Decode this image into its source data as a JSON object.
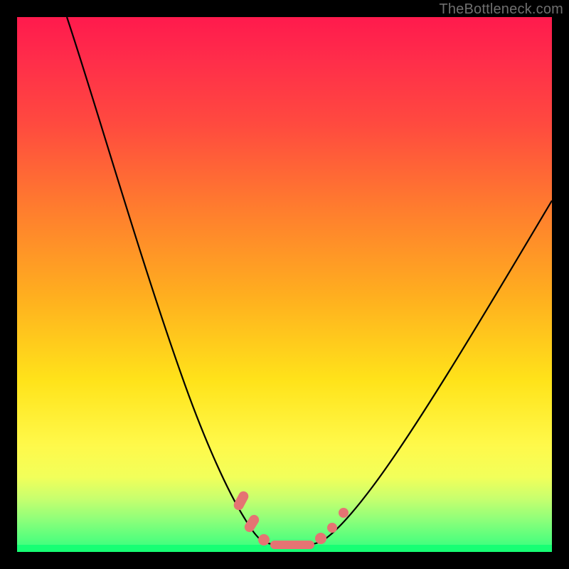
{
  "watermark": "TheBottleneck.com",
  "chart_data": {
    "type": "line",
    "title": "",
    "xlabel": "",
    "ylabel": "",
    "x_range": [
      0,
      100
    ],
    "y_range": [
      0,
      100
    ],
    "gradient_meaning": "vertical color gradient from red (top, ~100) to green (bottom, ~0)",
    "series": [
      {
        "name": "left-branch",
        "x": [
          10,
          14,
          18,
          22,
          26,
          30,
          34,
          37,
          39,
          41,
          43,
          44,
          45
        ],
        "y": [
          100,
          88,
          75,
          62,
          50,
          38,
          27,
          18,
          12,
          8,
          5,
          3,
          2
        ]
      },
      {
        "name": "valley-floor",
        "x": [
          45,
          47,
          49,
          51,
          53,
          55,
          57
        ],
        "y": [
          2,
          1.3,
          1,
          1,
          1,
          1.3,
          2
        ]
      },
      {
        "name": "right-branch",
        "x": [
          57,
          60,
          64,
          68,
          72,
          76,
          80,
          85,
          90,
          95,
          100
        ],
        "y": [
          2,
          4,
          8,
          13,
          19,
          26,
          33,
          42,
          50,
          58,
          66
        ]
      }
    ],
    "markers": [
      {
        "name": "left-upper-bead",
        "x": 41.5,
        "y": 9.5,
        "shape": "capsule",
        "angle_deg": -60
      },
      {
        "name": "left-lower-bead",
        "x": 43.5,
        "y": 5.0,
        "shape": "capsule",
        "angle_deg": -60
      },
      {
        "name": "floor-bead-1",
        "x": 46,
        "y": 1.6,
        "shape": "round"
      },
      {
        "name": "floor-bar",
        "x": 51,
        "y": 1.0,
        "shape": "bar"
      },
      {
        "name": "floor-bead-2",
        "x": 56,
        "y": 1.8,
        "shape": "round"
      },
      {
        "name": "right-lower-bead",
        "x": 58.5,
        "y": 4.0,
        "shape": "round-small"
      },
      {
        "name": "right-upper-bead",
        "x": 61,
        "y": 7.0,
        "shape": "round-small"
      }
    ]
  }
}
